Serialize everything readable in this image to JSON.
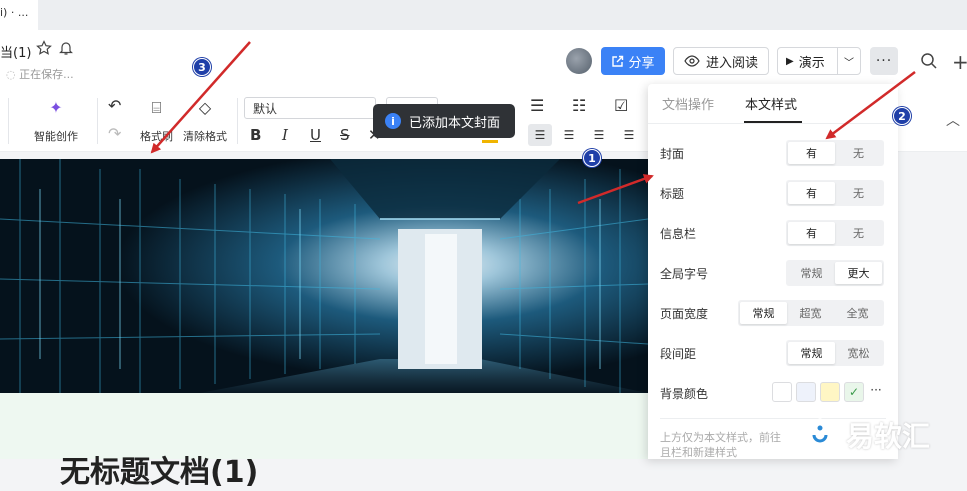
{
  "tab": {
    "title": "i) · ..."
  },
  "header": {
    "doc_title": "当(1)",
    "save_status": "正在保存...",
    "share_label": "分享",
    "read_label": "进入阅读",
    "present_label": "演示",
    "more_label": "···"
  },
  "toolbar": {
    "ai_label": "智能创作",
    "format_painter_label": "格式刷",
    "clear_format_label": "清除格式",
    "font_family": "默认",
    "bold": "B",
    "italic": "I",
    "underline": "U",
    "strike": "S"
  },
  "toast": {
    "text": "已添加本文封面"
  },
  "panel": {
    "tabs": [
      "文档操作",
      "本文样式"
    ],
    "rows": [
      {
        "label": "封面",
        "options": [
          "有",
          "无"
        ],
        "selected": 0
      },
      {
        "label": "标题",
        "options": [
          "有",
          "无"
        ],
        "selected": 0
      },
      {
        "label": "信息栏",
        "options": [
          "有",
          "无"
        ],
        "selected": 0
      },
      {
        "label": "全局字号",
        "options": [
          "常规",
          "更大"
        ],
        "selected": 1
      },
      {
        "label": "页面宽度",
        "options": [
          "常规",
          "超宽",
          "全宽"
        ],
        "selected": 0
      },
      {
        "label": "段间距",
        "options": [
          "常规",
          "宽松"
        ],
        "selected": 0
      },
      {
        "label": "背景颜色",
        "swatches": [
          "#ffffff",
          "#eef2fb",
          "#fff6c4",
          "#e9f6ea"
        ],
        "more": "···"
      }
    ],
    "note_line1": "上方仅为本文样式，前往",
    "note_line2": "且栏和新建样式"
  },
  "document": {
    "heading": "无标题文档(1)"
  },
  "annotations": [
    "1",
    "2",
    "3"
  ],
  "watermark": {
    "text": "易软汇"
  },
  "colors": {
    "accent": "#3b82f6",
    "annotation": "#d12a2a",
    "badge": "#1f3fa8"
  }
}
